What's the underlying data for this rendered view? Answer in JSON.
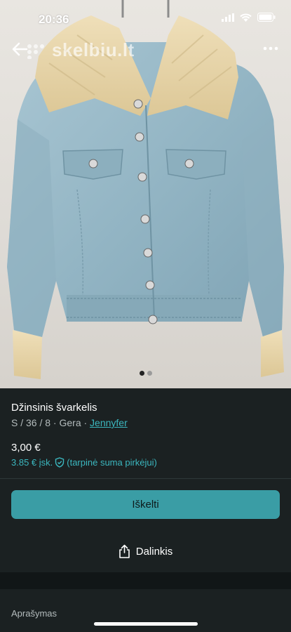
{
  "status_bar": {
    "time": "20:36"
  },
  "topbar": {
    "brand_watermark": "skelbiu.lt"
  },
  "gallery": {
    "image_count": 2,
    "active_index": 0
  },
  "listing": {
    "title": "Džinsinis švarkelis",
    "meta_prefix": "S / 36 / 8 · Gera · ",
    "brand": "Jennyfer",
    "price": "3,00 €",
    "buyer_price": "3.85 € įsk.",
    "buyer_note": "(tarpinė suma pirkėjui)"
  },
  "actions": {
    "primary_label": "Iškelti",
    "share_label": "Dalinkis"
  },
  "description": {
    "header": "Aprašymas"
  },
  "colors": {
    "accent": "#3a9da5",
    "link": "#3bb7bf",
    "background": "#1b2122"
  },
  "icons": [
    "back-arrow-icon",
    "more-icon",
    "shield-check-icon",
    "share-icon",
    "signal-icon",
    "wifi-icon",
    "battery-icon"
  ]
}
